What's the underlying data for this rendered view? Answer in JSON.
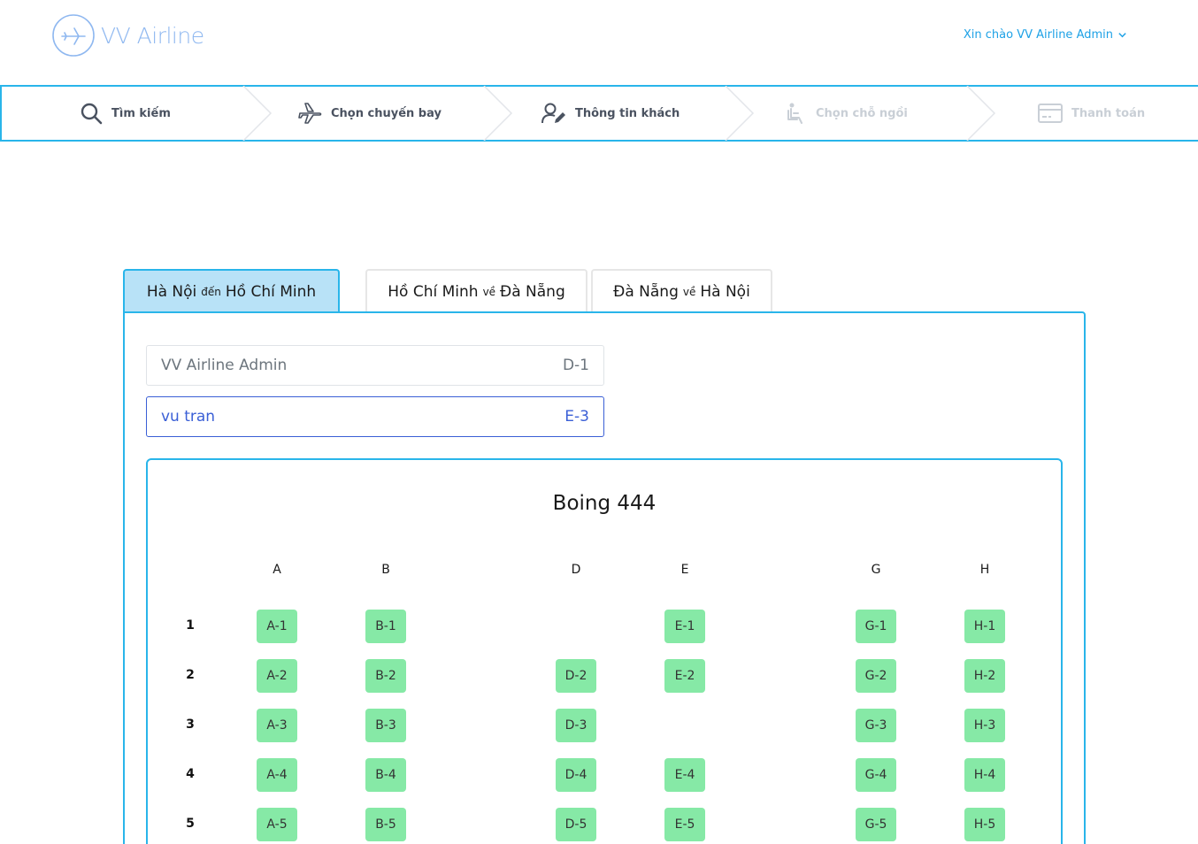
{
  "header": {
    "logo_text": "VV Airline",
    "greeting": "Xin chào VV Airline Admin"
  },
  "steps": [
    {
      "label": "Tìm kiếm",
      "icon": "search-icon",
      "enabled": true
    },
    {
      "label": "Chọn chuyến bay",
      "icon": "plane-icon",
      "enabled": true
    },
    {
      "label": "Thông tin khách",
      "icon": "user-edit-icon",
      "enabled": true
    },
    {
      "label": "Chọn chỗ ngồi",
      "icon": "seat-icon",
      "enabled": false
    },
    {
      "label": "Thanh toán",
      "icon": "credit-card-icon",
      "enabled": false
    }
  ],
  "tabs": [
    {
      "from": "Hà Nội",
      "connector": "đến",
      "to": "Hồ Chí Minh",
      "active": true
    },
    {
      "from": "Hồ Chí Minh",
      "connector": "về",
      "to": "Đà Nẵng",
      "active": false
    },
    {
      "from": "Đà Nẵng",
      "connector": "về",
      "to": "Hà Nội",
      "active": false
    }
  ],
  "passengers": [
    {
      "name": "VV Airline Admin",
      "seat": "D-1",
      "selected": false
    },
    {
      "name": "vu tran",
      "seat": "E-3",
      "selected": true
    }
  ],
  "plane": {
    "title": "Boing 444",
    "columns": [
      "A",
      "B",
      "D",
      "E",
      "G",
      "H"
    ],
    "rows": [
      "1",
      "2",
      "3",
      "4",
      "5"
    ],
    "seats": [
      [
        "A-1",
        "B-1",
        "",
        "E-1",
        "G-1",
        "H-1"
      ],
      [
        "A-2",
        "B-2",
        "D-2",
        "E-2",
        "G-2",
        "H-2"
      ],
      [
        "A-3",
        "B-3",
        "D-3",
        "",
        "G-3",
        "H-3"
      ],
      [
        "A-4",
        "B-4",
        "D-4",
        "E-4",
        "G-4",
        "H-4"
      ],
      [
        "A-5",
        "B-5",
        "D-5",
        "E-5",
        "G-5",
        "H-5"
      ]
    ]
  },
  "colors": {
    "accent": "#29b5ea",
    "available_seat": "#86e9a6",
    "selected_passenger": "#3a5fd6"
  }
}
